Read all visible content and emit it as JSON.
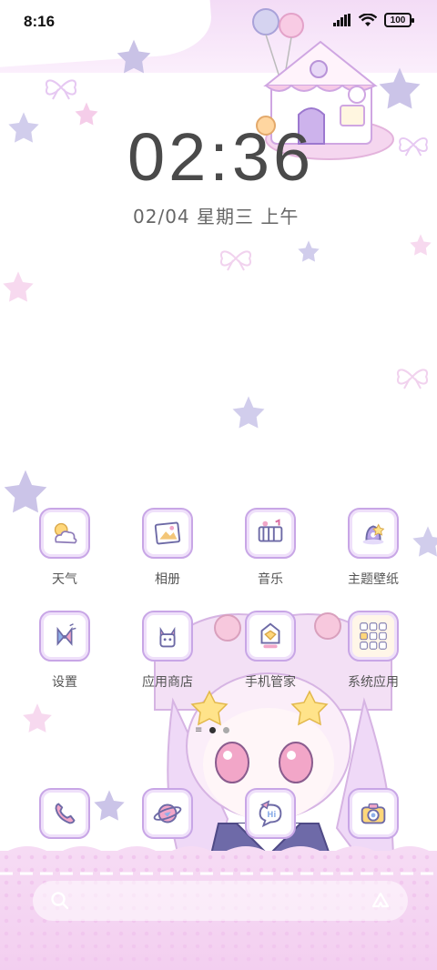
{
  "status_bar": {
    "time": "8:16",
    "battery": "100"
  },
  "clock": {
    "time": "02:36",
    "date": "02/04 星期三 上午"
  },
  "apps": [
    {
      "label": "天气",
      "icon": "weather-icon"
    },
    {
      "label": "相册",
      "icon": "gallery-icon"
    },
    {
      "label": "音乐",
      "icon": "music-icon"
    },
    {
      "label": "主题壁纸",
      "icon": "theme-icon"
    },
    {
      "label": "设置",
      "icon": "settings-icon"
    },
    {
      "label": "应用商店",
      "icon": "app-store-icon"
    },
    {
      "label": "手机管家",
      "icon": "phone-manager-icon"
    },
    {
      "label": "系统应用",
      "icon": "system-apps-folder-icon"
    }
  ],
  "dock": [
    {
      "icon": "phone-icon"
    },
    {
      "icon": "browser-icon"
    },
    {
      "icon": "messages-icon"
    },
    {
      "icon": "camera-icon"
    }
  ],
  "pages": {
    "count": 2,
    "active": 0
  },
  "colors": {
    "accent": "#c8a6e6",
    "background_pink": "#f3dcf6"
  }
}
